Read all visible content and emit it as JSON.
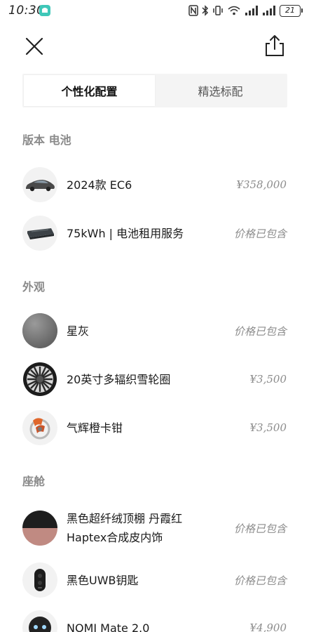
{
  "status_bar": {
    "time": "10:30",
    "battery": "21"
  },
  "header": {
    "close_icon": "close-icon",
    "share_icon": "share-icon"
  },
  "tabs": [
    {
      "label": "个性化配置",
      "active": true
    },
    {
      "label": "精选标配",
      "active": false
    }
  ],
  "sections": {
    "version": {
      "title": "版本 电池",
      "items": [
        {
          "label": "2024款 EC6",
          "price": "¥358,000"
        },
        {
          "label": "75kWh | 电池租用服务",
          "price": "价格已包含"
        }
      ]
    },
    "exterior": {
      "title": "外观",
      "items": [
        {
          "label": "星灰",
          "price": "价格已包含"
        },
        {
          "label": "20英寸多辐织雪轮圈",
          "price": "¥3,500"
        },
        {
          "label": "气辉橙卡钳",
          "price": "¥3,500"
        }
      ]
    },
    "cabin": {
      "title": "座舱",
      "items": [
        {
          "label_line1": "黑色超纤绒顶棚 丹霞红",
          "label_line2": "Haptex合成皮内饰",
          "price": "价格已包含"
        },
        {
          "label": "黑色UWB钥匙",
          "price": "价格已包含"
        },
        {
          "label": "NOMI Mate 2.0",
          "price": "¥4,900"
        }
      ]
    }
  },
  "colors": {
    "tab_bg": "#f4f4f4",
    "section_title": "#8a8a8a",
    "price": "#8c8c8c",
    "star_grey": "#7a7a7a",
    "caliper_orange": "#e0672b"
  }
}
